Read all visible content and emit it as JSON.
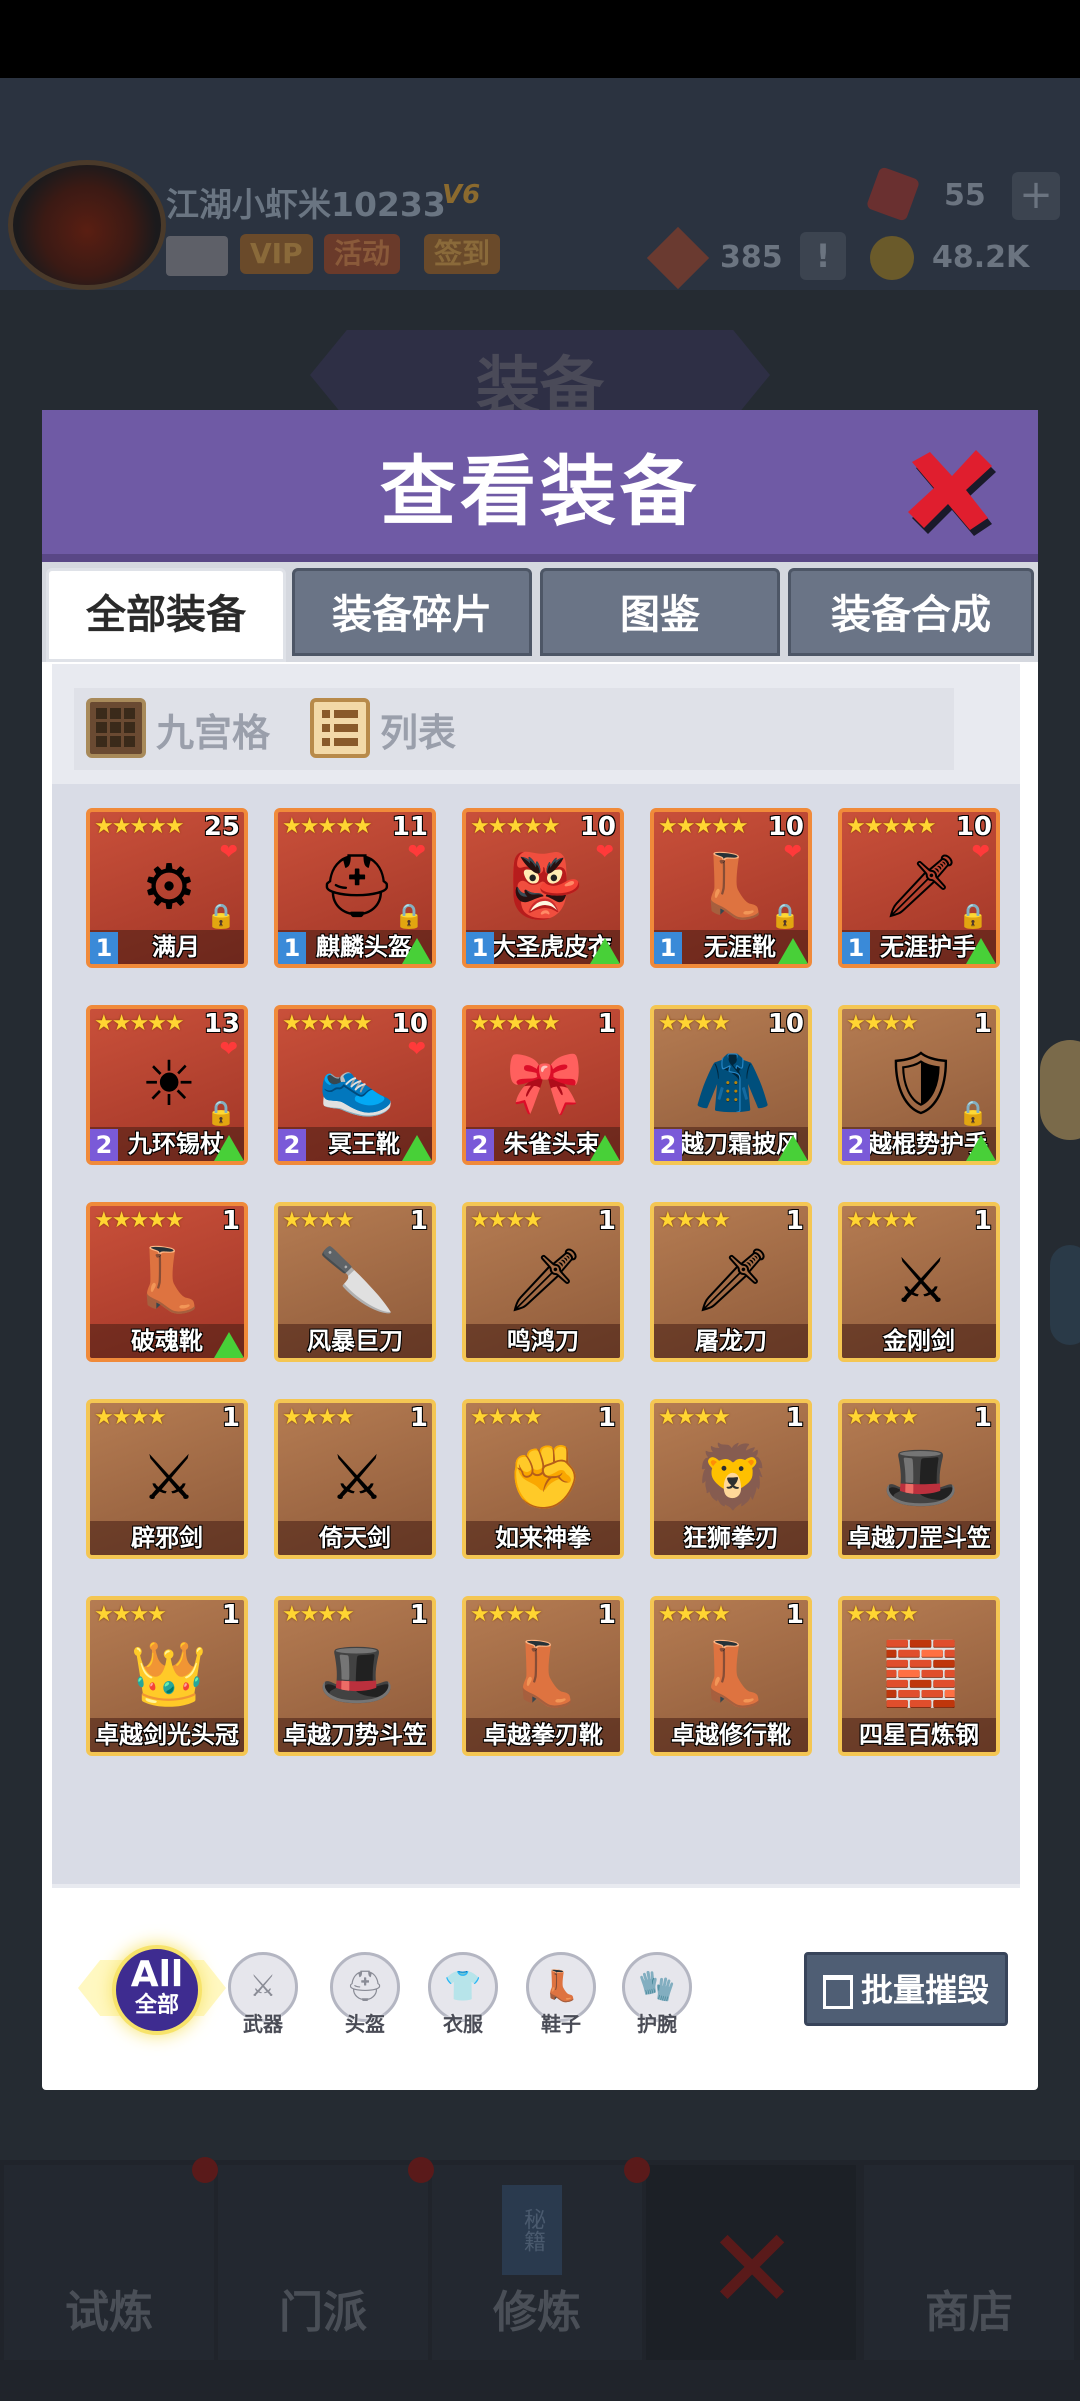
{
  "player": {
    "name": "江湖小虾米10233",
    "vip_level": "V6",
    "tags": [
      "VIP",
      "活动",
      "签到"
    ]
  },
  "resources": {
    "gems": "55",
    "tokens": "385",
    "coins": "48.2K"
  },
  "background": {
    "page_title": "装备",
    "nav": [
      "试炼",
      "门派",
      "修炼",
      "",
      "商店"
    ],
    "book_label": "秘籍"
  },
  "modal": {
    "title": "查看装备",
    "tabs": [
      "全部装备",
      "装备碎片",
      "图鉴",
      "装备合成"
    ],
    "active_tab": "全部装备",
    "view_modes": [
      "九宫格",
      "列表"
    ],
    "filters": {
      "all_top": "All",
      "all_bottom": "全部",
      "categories": [
        "武器",
        "头盔",
        "衣服",
        "鞋子",
        "护腕"
      ]
    },
    "destroy_label": "批量摧毁"
  },
  "items": [
    {
      "name": "满月",
      "stars": "★★★★★",
      "count": "25",
      "level": "1",
      "tier": "red",
      "locked": true,
      "heart": true,
      "upgrade": false,
      "icon": "⚙"
    },
    {
      "name": "麒麟头盔",
      "stars": "★★★★★",
      "count": "11",
      "level": "1",
      "tier": "red",
      "locked": true,
      "heart": true,
      "upgrade": true,
      "icon": "⛑"
    },
    {
      "name": "大圣虎皮衣",
      "stars": "★★★★★",
      "count": "10",
      "level": "1",
      "tier": "red",
      "locked": false,
      "heart": true,
      "upgrade": true,
      "icon": "👺"
    },
    {
      "name": "无涯靴",
      "stars": "★★★★★",
      "count": "10",
      "level": "1",
      "tier": "red",
      "locked": true,
      "heart": true,
      "upgrade": true,
      "icon": "👢"
    },
    {
      "name": "无涯护手",
      "stars": "★★★★★",
      "count": "10",
      "level": "1",
      "tier": "red",
      "locked": true,
      "heart": true,
      "upgrade": true,
      "icon": "🗡"
    },
    {
      "name": "九环锡杖",
      "stars": "★★★★★",
      "count": "13",
      "level": "2",
      "tier": "red",
      "locked": true,
      "heart": true,
      "upgrade": true,
      "icon": "☀"
    },
    {
      "name": "冥王靴",
      "stars": "★★★★★",
      "count": "10",
      "level": "2",
      "tier": "red",
      "locked": false,
      "heart": true,
      "upgrade": true,
      "icon": "👟"
    },
    {
      "name": "朱雀头束",
      "stars": "★★★★★",
      "count": "1",
      "level": "2",
      "tier": "red",
      "locked": false,
      "heart": false,
      "upgrade": true,
      "icon": "🎀"
    },
    {
      "name": "越刀霜披风",
      "stars": "★★★★",
      "count": "10",
      "level": "2",
      "tier": "gold",
      "locked": false,
      "heart": false,
      "upgrade": true,
      "icon": "🧥"
    },
    {
      "name": "越棍势护手",
      "stars": "★★★★",
      "count": "1",
      "level": "2",
      "tier": "gold",
      "locked": true,
      "heart": false,
      "upgrade": true,
      "icon": "🛡"
    },
    {
      "name": "破魂靴",
      "stars": "★★★★★",
      "count": "1",
      "level": "",
      "tier": "red",
      "locked": false,
      "heart": false,
      "upgrade": true,
      "icon": "👢"
    },
    {
      "name": "风暴巨刀",
      "stars": "★★★★",
      "count": "1",
      "level": "",
      "tier": "gold",
      "locked": false,
      "heart": false,
      "upgrade": false,
      "icon": "🔪"
    },
    {
      "name": "鸣鸿刀",
      "stars": "★★★★",
      "count": "1",
      "level": "",
      "tier": "gold",
      "locked": false,
      "heart": false,
      "upgrade": false,
      "icon": "🗡"
    },
    {
      "name": "屠龙刀",
      "stars": "★★★★",
      "count": "1",
      "level": "",
      "tier": "gold",
      "locked": false,
      "heart": false,
      "upgrade": false,
      "icon": "🗡"
    },
    {
      "name": "金刚剑",
      "stars": "★★★★",
      "count": "1",
      "level": "",
      "tier": "gold",
      "locked": false,
      "heart": false,
      "upgrade": false,
      "icon": "⚔"
    },
    {
      "name": "辟邪剑",
      "stars": "★★★★",
      "count": "1",
      "level": "",
      "tier": "gold",
      "locked": false,
      "heart": false,
      "upgrade": false,
      "icon": "⚔"
    },
    {
      "name": "倚天剑",
      "stars": "★★★★",
      "count": "1",
      "level": "",
      "tier": "gold",
      "locked": false,
      "heart": false,
      "upgrade": false,
      "icon": "⚔"
    },
    {
      "name": "如来神拳",
      "stars": "★★★★",
      "count": "1",
      "level": "",
      "tier": "gold",
      "locked": false,
      "heart": false,
      "upgrade": false,
      "icon": "✊"
    },
    {
      "name": "狂狮拳刃",
      "stars": "★★★★",
      "count": "1",
      "level": "",
      "tier": "gold",
      "locked": false,
      "heart": false,
      "upgrade": false,
      "icon": "🦁"
    },
    {
      "name": "卓越刀罡斗笠",
      "stars": "★★★★",
      "count": "1",
      "level": "",
      "tier": "gold",
      "locked": false,
      "heart": false,
      "upgrade": false,
      "icon": "🎩"
    },
    {
      "name": "卓越剑光头冠",
      "stars": "★★★★",
      "count": "1",
      "level": "",
      "tier": "gold",
      "locked": false,
      "heart": false,
      "upgrade": false,
      "icon": "👑"
    },
    {
      "name": "卓越刀势斗笠",
      "stars": "★★★★",
      "count": "1",
      "level": "",
      "tier": "gold",
      "locked": false,
      "heart": false,
      "upgrade": false,
      "icon": "🎩"
    },
    {
      "name": "卓越拳刃靴",
      "stars": "★★★★",
      "count": "1",
      "level": "",
      "tier": "gold",
      "locked": false,
      "heart": false,
      "upgrade": false,
      "icon": "👢"
    },
    {
      "name": "卓越修行靴",
      "stars": "★★★★",
      "count": "1",
      "level": "",
      "tier": "gold",
      "locked": false,
      "heart": false,
      "upgrade": false,
      "icon": "👢"
    },
    {
      "name": "四星百炼钢",
      "stars": "★★★★",
      "count": "",
      "level": "",
      "tier": "gold",
      "locked": false,
      "heart": false,
      "upgrade": false,
      "icon": "🧱"
    }
  ]
}
